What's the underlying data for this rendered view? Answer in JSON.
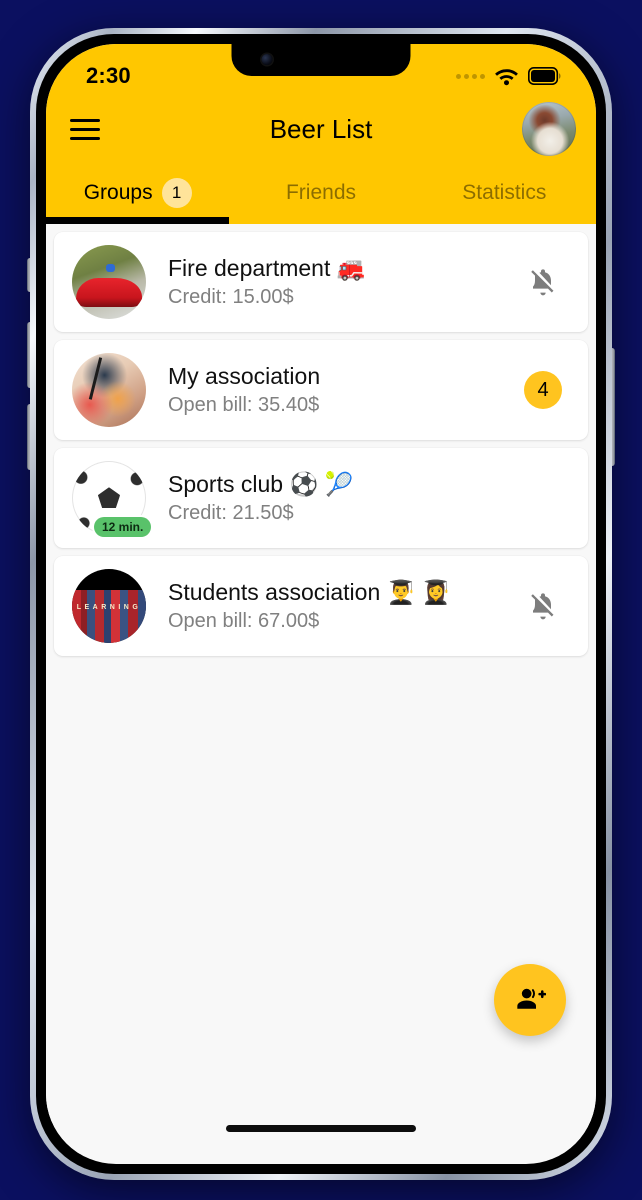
{
  "status_bar": {
    "time": "2:30",
    "signal_icon": "signal-dots-icon",
    "wifi_icon": "wifi-icon",
    "battery_icon": "battery-full-icon"
  },
  "app_bar": {
    "menu_icon": "hamburger-menu-icon",
    "title": "Beer List",
    "avatar_icon": "profile-avatar"
  },
  "tabs": {
    "active_index": 0,
    "items": [
      {
        "label": "Groups",
        "badge": "1"
      },
      {
        "label": "Friends",
        "badge": ""
      },
      {
        "label": "Statistics",
        "badge": ""
      }
    ]
  },
  "groups": [
    {
      "name": "Fire department 🚒",
      "balance_label": "Credit: 15.00$",
      "avatar": "fire-truck-avatar",
      "trailing_type": "bell-off-icon",
      "trailing_value": "",
      "time_badge": ""
    },
    {
      "name": "My association",
      "balance_label": "Open bill: 35.40$",
      "avatar": "drinks-cheers-avatar",
      "trailing_type": "count-badge",
      "trailing_value": "4",
      "time_badge": ""
    },
    {
      "name": "Sports club ⚽ 🎾",
      "balance_label": "Credit: 21.50$",
      "avatar": "soccer-ball-avatar",
      "trailing_type": "none",
      "trailing_value": "",
      "time_badge": "12 min."
    },
    {
      "name": "Students association 👨‍🎓 👩‍🎓",
      "balance_label": "Open bill: 67.00$",
      "avatar": "books-learning-avatar",
      "trailing_type": "bell-off-icon",
      "trailing_value": "",
      "time_badge": ""
    }
  ],
  "fab": {
    "icon": "person-add-icon"
  },
  "colors": {
    "accent_yellow": "#ffc700",
    "badge_yellow": "#ffc41f",
    "tab_badge_yellow": "#ffe49a",
    "time_badge_green": "#59c26a",
    "page_background": "#0b1060",
    "surface": "#ffffff",
    "list_background": "#f8f8f8"
  }
}
